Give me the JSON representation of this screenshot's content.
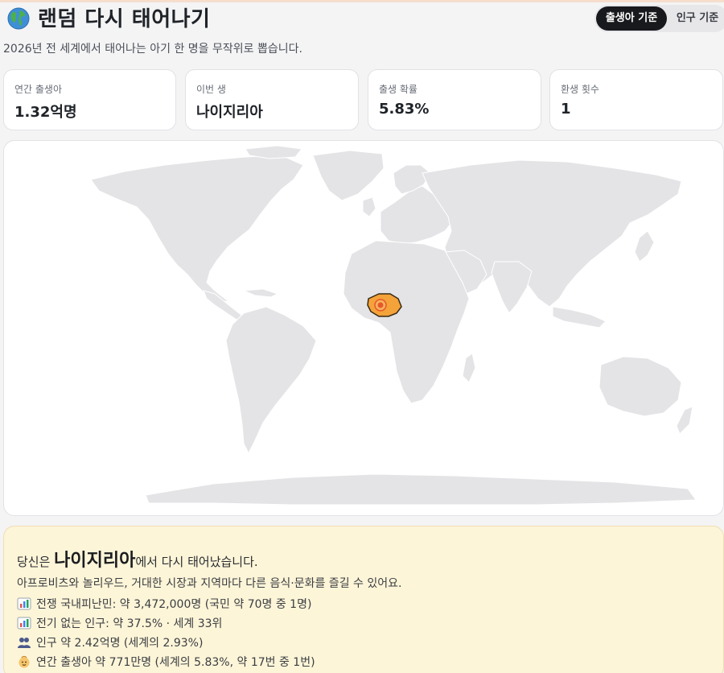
{
  "header": {
    "title": "랜덤 다시 태어나기",
    "subtitle": "2026년 전 세계에서 태어나는 아기 한 명을 무작위로 뽑습니다.",
    "toggle": {
      "active": "출생아 기준",
      "inactive": "인구 기준"
    }
  },
  "stats": [
    {
      "label": "연간 출생아",
      "value": "1.32억명"
    },
    {
      "label": "이번 생",
      "value": "나이지리아"
    },
    {
      "label": "출생 확률",
      "value": "5.83%"
    },
    {
      "label": "환생 횟수",
      "value": "1"
    }
  ],
  "map": {
    "highlight_color": "#f4a23a",
    "marker_color": "#e8572b"
  },
  "result": {
    "prefix": "당신은 ",
    "country": "나이지리아",
    "suffix": "에서 다시 태어났습니다.",
    "description": "아프로비츠와 놀리우드, 거대한 시장과 지역마다 다른 음식·문화를 즐길 수 있어요.",
    "facts": [
      {
        "icon": "bar-chart-icon",
        "text": "전쟁 국내피난민: 약 3,472,000명 (국민 약 70명 중 1명)"
      },
      {
        "icon": "bar-chart-icon",
        "text": "전기 없는 인구: 약 37.5% · 세계 33위"
      },
      {
        "icon": "people-icon",
        "text": "인구 약 2.42억명 (세계의 2.93%)"
      },
      {
        "icon": "baby-icon",
        "text": "연간 출생아 약 771만명 (세계의 5.83%, 약 17번 중 1번)"
      }
    ]
  }
}
